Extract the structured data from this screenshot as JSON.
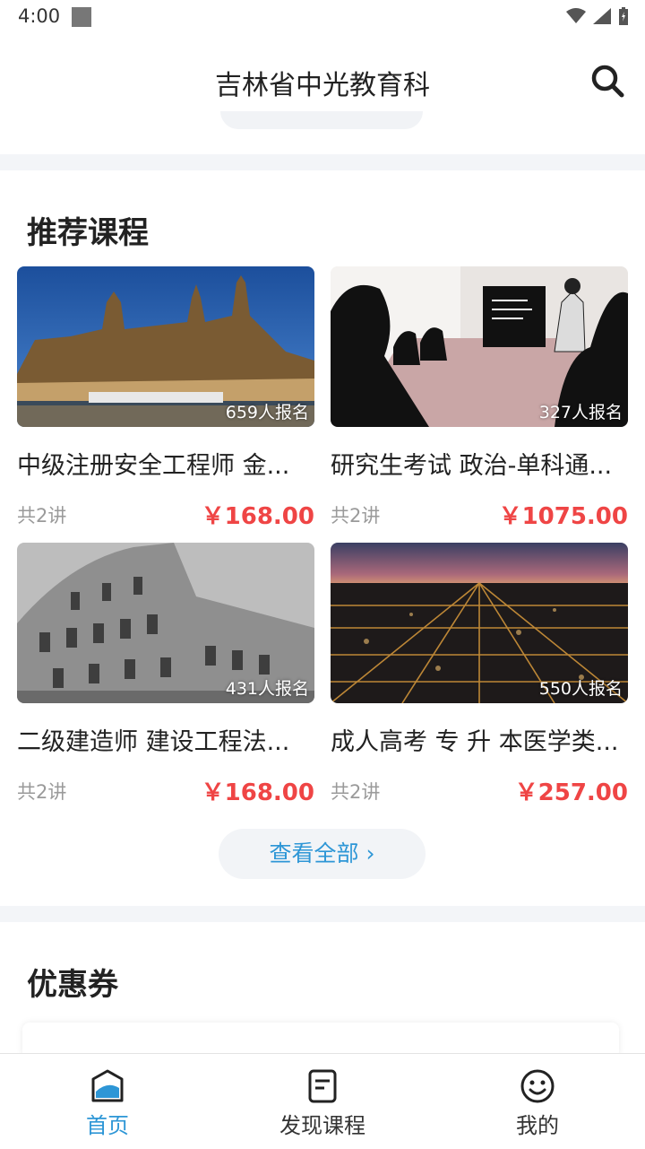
{
  "status_bar": {
    "time": "4:00"
  },
  "header": {
    "title": "吉林省中光教育科"
  },
  "recommended": {
    "title": "推荐课程",
    "courses": [
      {
        "name": "中级注册安全工程师 金...",
        "enroll": "659人报名",
        "lessons": "共2讲",
        "price": "￥168.00"
      },
      {
        "name": "研究生考试 政治-单科通...",
        "enroll": "327人报名",
        "lessons": "共2讲",
        "price": "￥1075.00"
      },
      {
        "name": "二级建造师 建设工程法...",
        "enroll": "431人报名",
        "lessons": "共2讲",
        "price": "￥168.00"
      },
      {
        "name": "成人高考 专 升 本医学类...",
        "enroll": "550人报名",
        "lessons": "共2讲",
        "price": "￥257.00"
      }
    ],
    "view_all": "查看全部 ›"
  },
  "coupons": {
    "title": "优惠券"
  },
  "tabbar": {
    "home": "首页",
    "discover": "发现课程",
    "mine": "我的"
  },
  "colors": {
    "accent": "#2d96d6",
    "price": "#ef4545"
  }
}
